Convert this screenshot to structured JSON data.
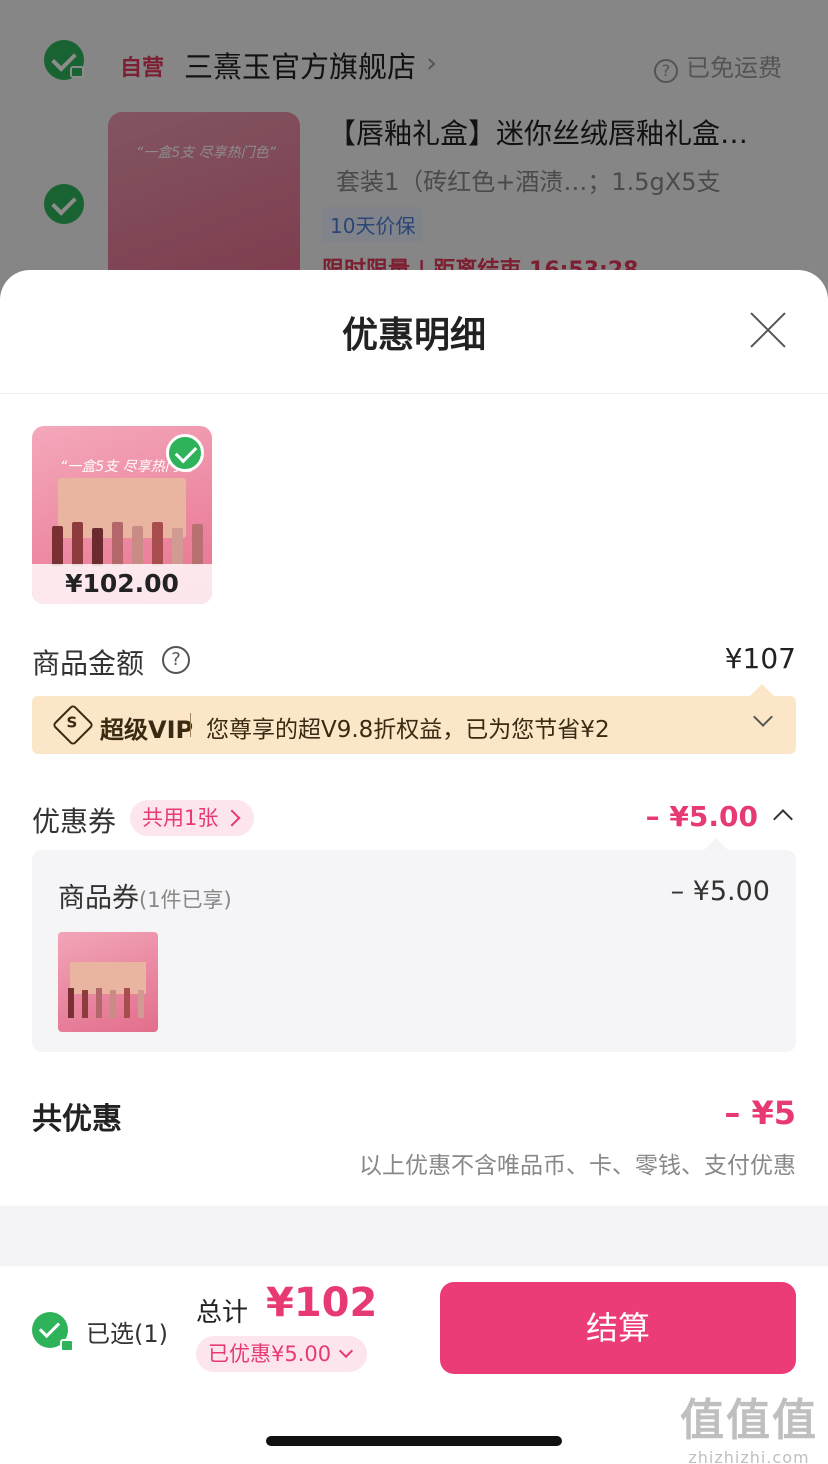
{
  "background": {
    "store_tag": "自营",
    "store_name": "三熹玉官方旗舰店",
    "free_shipping": "已免运费",
    "product_title": "【唇釉礼盒】迷你丝绒唇釉礼盒…",
    "product_spec": "套装1（砖红色+酒渍…；1.5gX5支",
    "guarantee_tag": "10天价保",
    "flash_sale": "限时限量 | 距离结束 16:53:28",
    "thumb_headline": "“一盒5支 尽享热门色”"
  },
  "sheet": {
    "title": "优惠明细",
    "product": {
      "price": "¥102.00",
      "thumb_headline": "“一盒5支 尽享热门色”"
    },
    "amount": {
      "label": "商品金额",
      "value": "¥107"
    },
    "vip": {
      "name": "超级VIP",
      "text": "您尊享的超V9.8折权益，已为您节省¥2"
    },
    "coupon": {
      "label": "优惠券",
      "chip": "共用1张",
      "value": "– ¥5.00",
      "item_title": "商品券",
      "item_sub": "(1件已享)",
      "item_value": "– ¥5.00"
    },
    "total_discount": {
      "label": "共优惠",
      "value": "– ¥5"
    },
    "note": "以上优惠不含唯品币、卡、零钱、支付优惠"
  },
  "bottom_bar": {
    "selected": "已选(1)",
    "total_label": "总计",
    "total_value": "¥102",
    "saved": "已优惠¥5.00",
    "checkout": "结算"
  },
  "watermark": {
    "big": "值值值",
    "small": "zhizhizhi.com"
  },
  "colors": {
    "accent": "#ec3c78",
    "check": "#2fb35a",
    "vip_bg": "#fbe7c8"
  },
  "icons": [
    "check-icon",
    "lock-icon",
    "help-icon",
    "close-icon",
    "vip-badge-icon",
    "chevron-down-icon",
    "chevron-right-icon",
    "chevron-up-icon"
  ]
}
